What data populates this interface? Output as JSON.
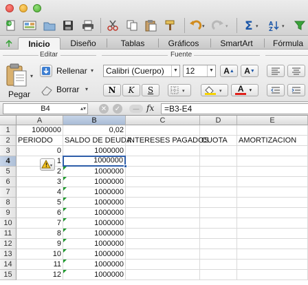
{
  "ribbon": {
    "tabs": [
      {
        "label": "Inicio",
        "active": true
      },
      {
        "label": "Diseño",
        "active": false
      },
      {
        "label": "Tablas",
        "active": false
      },
      {
        "label": "Gráficos",
        "active": false
      },
      {
        "label": "SmartArt",
        "active": false
      },
      {
        "label": "Fórmula",
        "active": false
      }
    ],
    "groups": {
      "edit": "Editar",
      "font": "Fuente"
    },
    "paste_label": "Pegar",
    "fill_label": "Rellenar",
    "clear_label": "Borrar",
    "font_name": "Calibri (Cuerpo)",
    "font_size": "12",
    "bold": "N",
    "italic": "K",
    "underline": "S",
    "grow_font": "A",
    "shrink_font": "A",
    "font_color": "A",
    "accent_fill": "#f5d100",
    "accent_font": "#e0201a"
  },
  "formula_bar": {
    "name_box": "B4",
    "fx": "fx",
    "formula": "=B3-E4"
  },
  "sheet": {
    "columns": [
      "A",
      "B",
      "C",
      "D",
      "E"
    ],
    "selected_column": "B",
    "selected_row": 4,
    "row_numbers": [
      "1",
      "2",
      "3",
      "4",
      "5",
      "6",
      "7",
      "8",
      "9",
      "10",
      "11",
      "12",
      "13",
      "14",
      "15"
    ],
    "rows": [
      [
        "1000000",
        "0,02",
        "",
        "",
        ""
      ],
      [
        "PERIODO",
        "SALDO DE DEUDA",
        "INTERESES PAGADOS",
        "CUOTA",
        "AMORTIZACION"
      ],
      [
        "0",
        "1000000",
        "",
        "",
        ""
      ],
      [
        "1",
        "1000000",
        "",
        "",
        ""
      ],
      [
        "2",
        "1000000",
        "",
        "",
        ""
      ],
      [
        "3",
        "1000000",
        "",
        "",
        ""
      ],
      [
        "4",
        "1000000",
        "",
        "",
        ""
      ],
      [
        "5",
        "1000000",
        "",
        "",
        ""
      ],
      [
        "6",
        "1000000",
        "",
        "",
        ""
      ],
      [
        "7",
        "1000000",
        "",
        "",
        ""
      ],
      [
        "8",
        "1000000",
        "",
        "",
        ""
      ],
      [
        "9",
        "1000000",
        "",
        "",
        ""
      ],
      [
        "10",
        "1000000",
        "",
        "",
        ""
      ],
      [
        "11",
        "1000000",
        "",
        "",
        ""
      ],
      [
        "12",
        "1000000",
        "",
        "",
        ""
      ]
    ],
    "error_indicator_color": "#1f9a2e",
    "selection_color": "#2d5da8"
  }
}
